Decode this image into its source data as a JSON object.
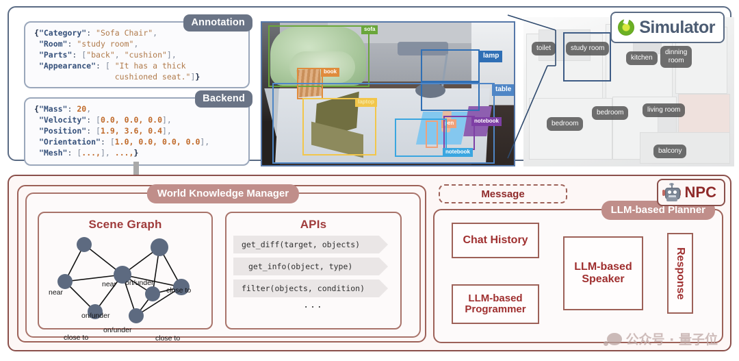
{
  "simulator": {
    "title": "Simulator",
    "logo_icon": "green-ring-logo-icon",
    "annotation": {
      "tag": "Annotation",
      "lines": [
        "{\"Category\": \"Sofa Chair\",",
        " \"Room\": \"study room\",",
        " \"Parts\": [\"back\", \"cushion\"],",
        " \"Appearance\": [ \"It has a thick",
        "                 cushioned seat.\"]}"
      ]
    },
    "backend": {
      "tag": "Backend",
      "lines": [
        "{\"Mass\": 20,",
        " \"Velocity\": [0.0, 0.0, 0.0],",
        " \"Position\": [1.9, 3.6, 0.4],",
        " \"Orientation\": [1.0, 0.0, 0.0, 0.0],",
        " \"Mesh\": [...,], ...,}"
      ]
    },
    "scene_labels": [
      {
        "name": "sofa",
        "color": "#6aa63b"
      },
      {
        "name": "book",
        "color": "#e08b3c"
      },
      {
        "name": "lamp",
        "color": "#2f6fb5"
      },
      {
        "name": "table",
        "color": "#4f86c6"
      },
      {
        "name": "laptop",
        "color": "#f2c64a"
      },
      {
        "name": "pen",
        "color": "#f0a17a"
      },
      {
        "name": "notebook",
        "color": "#7e3fa5"
      },
      {
        "name": "notebook",
        "color": "#3aa6e0"
      }
    ],
    "rooms": [
      {
        "label": "toilet"
      },
      {
        "label": "study room"
      },
      {
        "label": "kitchen"
      },
      {
        "label": "dinning\nroom"
      },
      {
        "label": "bedroom"
      },
      {
        "label": "bedroom"
      },
      {
        "label": "living room"
      },
      {
        "label": "balcony"
      }
    ]
  },
  "npc": {
    "title": "NPC",
    "robot_icon": "robot-icon",
    "world_knowledge_manager": {
      "pill": "World Knowledge Manager",
      "scene_graph": {
        "title": "Scene Graph",
        "edge_labels": [
          "near",
          "near",
          "on/under",
          "close to",
          "on/under",
          "on/under",
          "close to",
          "close to"
        ]
      },
      "apis": {
        "title": "APIs",
        "items": [
          "get_diff(target, objects)",
          "get_info(object, type)",
          "filter(objects, condition)"
        ],
        "more": "..."
      }
    },
    "message": "Message",
    "planner": {
      "pill": "LLM-based Planner",
      "chat_history": "Chat History",
      "programmer": "LLM-based\nProgrammer",
      "speaker": "LLM-based\nSpeaker",
      "response": "Response"
    }
  },
  "watermark": "公众号 · 量子位",
  "colors": {
    "simulator_border": "#5a6b84",
    "npc_border": "#8a4f4a",
    "pill": "#c08e8a",
    "heading_red": "#9f3b3b"
  }
}
